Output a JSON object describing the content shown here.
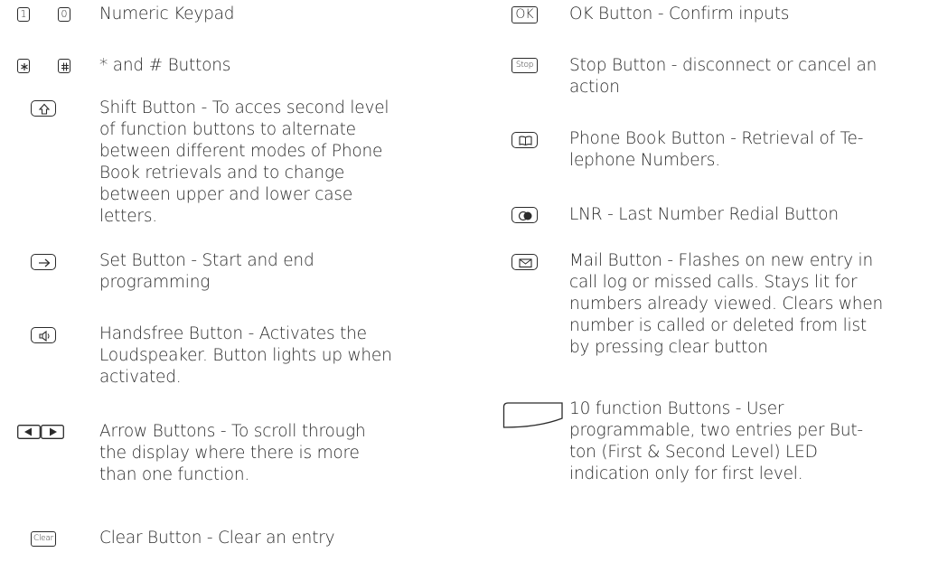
{
  "left": {
    "keypad": {
      "key1": "1",
      "key2": "0",
      "label": "Numeric Keypad"
    },
    "star_hash": {
      "label": "* and # Buttons"
    },
    "shift": {
      "label": "Shift Button - To acces second level\nof function buttons to alternate\nbetween different modes of Phone\nBook retrievals and to change\nbetween upper and lower case\nletters."
    },
    "set": {
      "label": "Set Button - Start and end\nprogramming"
    },
    "handsfree": {
      "label": "Handsfree Button - Activates the\nLoudspeaker. Button lights up when\nactivated."
    },
    "arrow": {
      "label": "Arrow Buttons - To scroll through\nthe display where there is more\nthan one function."
    },
    "clear": {
      "key": "Clear",
      "label": "Clear Button - Clear an entry"
    }
  },
  "right": {
    "ok": {
      "key": "OK",
      "label": "OK Button - Confirm inputs"
    },
    "stop": {
      "key": "Stop",
      "label": "Stop Button - disconnect or cancel an\naction"
    },
    "phonebook": {
      "label": "Phone Book Button - Retrieval of Te-\nlephone Numbers."
    },
    "lnr": {
      "label": "LNR - Last Number Redial Button"
    },
    "mail": {
      "label": "Mail Button - Flashes on new entry in\ncall log or missed calls. Stays lit for\nnumbers already viewed. Clears when\nnumber is called or deleted from list\nby pressing clear button"
    },
    "function": {
      "label": "10 function Buttons -  User\nprogrammable, two entries per But-\nton (First & Second Level) LED\nindication only for first level."
    }
  },
  "icons": {
    "star": "asterisk-key-icon",
    "hash": "hash-key-icon",
    "shift": "shift-arrow-icon",
    "set": "set-arrow-icon",
    "handsfree": "speaker-icon",
    "arrows": "left-right-arrow-icons",
    "phonebook": "book-icon",
    "lnr": "redial-icon",
    "mail": "envelope-icon",
    "function": "function-key-icon"
  }
}
